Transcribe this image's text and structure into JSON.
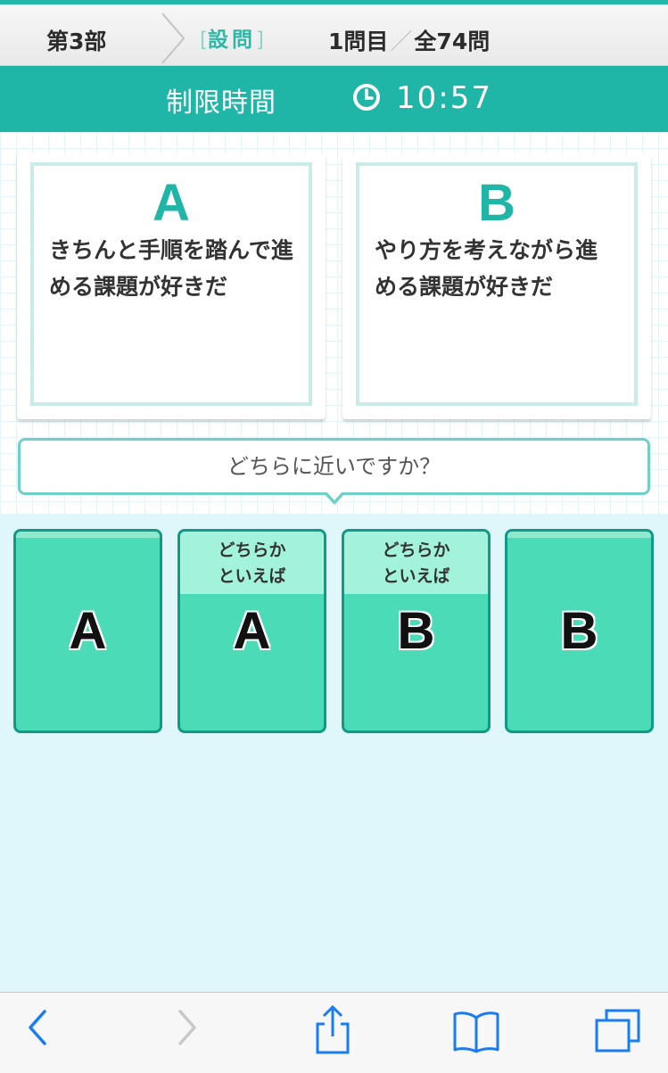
{
  "header": {
    "part": "第3部",
    "section_badge": "設問",
    "question_current": "1問目",
    "question_total": "全74問"
  },
  "timer": {
    "label": "制限時間",
    "value": "10:57",
    "icon": "clock-icon"
  },
  "options": {
    "a": {
      "letter": "A",
      "statement": "きちんと手順を踏んで進める課題が好きだ"
    },
    "b": {
      "letter": "B",
      "statement": "やり方を考えながら進める課題が好きだ"
    }
  },
  "question_prompt": "どちらに近いですか？",
  "answers": [
    {
      "label": "A",
      "sub": ""
    },
    {
      "label": "A",
      "sub_line1": "どちらか",
      "sub_line2": "といえば"
    },
    {
      "label": "B",
      "sub_line1": "どちらか",
      "sub_line2": "といえば"
    },
    {
      "label": "B",
      "sub": ""
    }
  ],
  "browser_toolbar": {
    "icons": [
      "back-icon",
      "forward-icon",
      "share-icon",
      "bookmarks-icon",
      "tabs-icon"
    ]
  },
  "colors": {
    "accent": "#1fb5a7",
    "answer_fill": "#4cdbb7",
    "answer_border": "#129a88",
    "background": "#dff6fb"
  }
}
